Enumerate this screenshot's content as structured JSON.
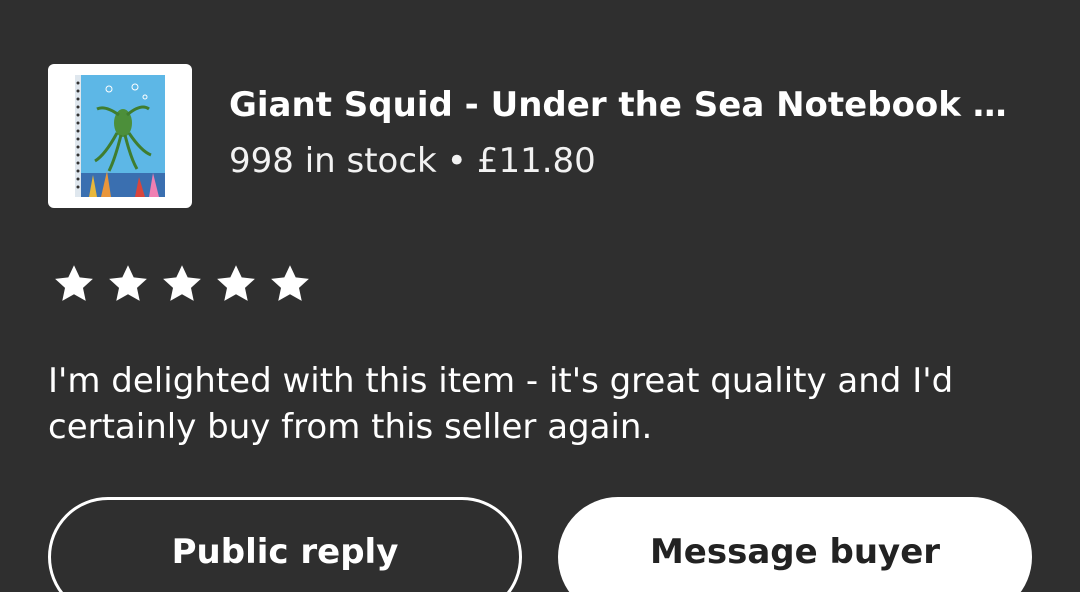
{
  "listing": {
    "title": "Giant Squid - Under the Sea Notebook | ...",
    "stock": "998 in stock",
    "separator": "•",
    "price": "£11.80",
    "thumbnail_icon": "notebook-thumbnail"
  },
  "review": {
    "rating": 5,
    "rating_max": 5,
    "text": "I'm delighted with this item - it's great quality and I'd certainly buy from this seller again."
  },
  "actions": {
    "public_reply_label": "Public reply",
    "message_buyer_label": "Message buyer"
  },
  "colors": {
    "background": "#2f2f2f",
    "text": "#ffffff",
    "button_solid_bg": "#ffffff",
    "button_solid_text": "#222222"
  }
}
